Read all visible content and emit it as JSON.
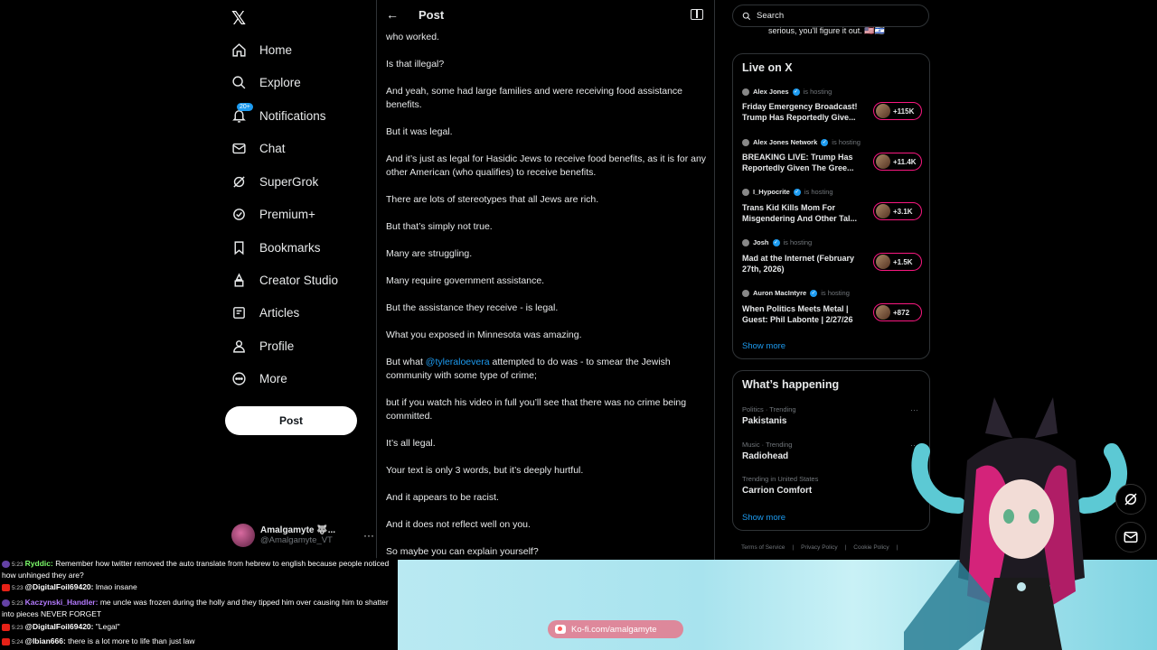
{
  "nav": {
    "items": [
      {
        "label": "Home",
        "icon": "home-icon"
      },
      {
        "label": "Explore",
        "icon": "search-icon"
      },
      {
        "label": "Notifications",
        "icon": "bell-icon",
        "badge": "20+"
      },
      {
        "label": "Chat",
        "icon": "mail-icon"
      },
      {
        "label": "SuperGrok",
        "icon": "grok-icon"
      },
      {
        "label": "Premium+",
        "icon": "premium-icon"
      },
      {
        "label": "Bookmarks",
        "icon": "bookmark-icon"
      },
      {
        "label": "Creator Studio",
        "icon": "creator-studio-icon"
      },
      {
        "label": "Articles",
        "icon": "articles-icon"
      },
      {
        "label": "Profile",
        "icon": "profile-icon"
      },
      {
        "label": "More",
        "icon": "more-icon"
      }
    ],
    "post_button": "Post",
    "account": {
      "name": "Amalgamyte 🐺...",
      "handle": "@Amalgamyte_VT",
      "more": "···"
    }
  },
  "post": {
    "header_title": "Post",
    "paragraphs": [
      "who worked.",
      "Is that illegal?",
      "And yeah, some had large families and were receiving food assistance benefits.",
      "But it was legal.",
      "And it’s just as legal for Hasidic Jews to receive food benefits, as it is for any other American (who qualifies) to receive benefits.",
      "There are lots of stereotypes that all Jews are rich.",
      "But that’s simply not true.",
      "Many are struggling.",
      "Many require government assistance.",
      "But the assistance they receive - is legal.",
      "What you exposed in Minnesota was amazing."
    ],
    "mention_para": {
      "before": "But what ",
      "mention": "@tyleraloevera",
      "after": " attempted to do was - to smear the Jewish community with some type of crime;"
    },
    "paragraphs2": [
      "but if you watch his video in full you’ll see that there was no crime being committed.",
      "It’s all legal.",
      "Your text is only 3 words, but it’s deeply hurtful.",
      "And it appears to be racist.",
      "And it does not reflect well on you.",
      "So maybe you can explain yourself?"
    ]
  },
  "right": {
    "search_placeholder": "Search",
    "truncated_text": "serious, you'll figure it out. 🇺🇸🇮🇱",
    "live": {
      "title": "Live on X",
      "hosting_label": "is hosting",
      "items": [
        {
          "host": "Alex Jones",
          "title": "Friday Emergency Broadcast! Trump Has Reportedly Give...",
          "count": "+115K"
        },
        {
          "host": "Alex Jones Network",
          "title": "BREAKING LIVE: Trump Has Reportedly Given The Gree...",
          "count": "+11.4K"
        },
        {
          "host": "I_Hypocrite",
          "title": "Trans Kid Kills Mom For Misgendering And Other Tal...",
          "count": "+3.1K"
        },
        {
          "host": "Josh",
          "title": "Mad at the Internet (February 27th, 2026)",
          "count": "+1.5K"
        },
        {
          "host": "Auron MacIntyre",
          "title": "When Politics Meets Metal | Guest: Phil Labonte | 2/27/26",
          "count": "+872"
        }
      ],
      "show_more": "Show more"
    },
    "happening": {
      "title": "What’s happening",
      "trends": [
        {
          "meta": "Politics · Trending",
          "name": "Pakistanis"
        },
        {
          "meta": "Music · Trending",
          "name": "Radiohead"
        },
        {
          "meta": "Trending in United States",
          "name": "Carrion Comfort"
        }
      ],
      "show_more": "Show more"
    },
    "footer": [
      "Terms of Service",
      "|",
      "Privacy Policy",
      "|",
      "Cookie Policy",
      "|"
    ]
  },
  "chat": [
    {
      "platform": "twitch",
      "time": "5:23",
      "user": "Ryddic:",
      "text": " Remember how twitter removed the auto translate from hebrew to english because people noticed how unhinged they are?"
    },
    {
      "platform": "youtube",
      "time": "5:23",
      "user": "@DigitalFoil69420:",
      "text": " lmao insane"
    },
    {
      "platform": "twitch",
      "time": "5:23",
      "user": "Kaczynski_Handler:",
      "text": " me uncle was frozen during the holly and they tipped him over causing him to shatter into pieces NEVER FORGET"
    },
    {
      "platform": "youtube",
      "time": "5:23",
      "user": "@DigitalFoil69420:",
      "text": " \"Legal\""
    },
    {
      "platform": "youtube",
      "time": "5:24",
      "user": "@lbian666:",
      "text": " there is a lot more to life than just law"
    }
  ],
  "kofi": "Ko-fi.com/amalgamyte",
  "colors": {
    "accent": "#1d9bf0",
    "live_pink": "#f91880",
    "banner": "#a8e3ee"
  }
}
